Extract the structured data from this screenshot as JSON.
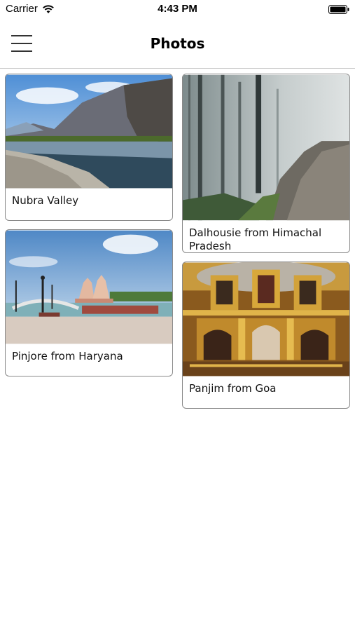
{
  "status_bar": {
    "carrier": "Carrier",
    "time": "4:43 PM",
    "wifi_icon": "wifi-icon",
    "battery_icon": "battery-icon"
  },
  "nav": {
    "title": "Photos",
    "menu_icon": "hamburger-menu-icon"
  },
  "photos": [
    {
      "caption": "Nubra Valley",
      "image": "mountain-lake-photo"
    },
    {
      "caption": "Dalhousie from Himachal Pradesh",
      "image": "misty-forest-path-photo"
    },
    {
      "caption": "Pinjore from Haryana",
      "image": "garden-bridge-temple-photo"
    },
    {
      "caption": "Panjim from Goa",
      "image": "golden-church-altar-photo"
    }
  ],
  "colors": {
    "card_border": "#8a8a8a",
    "divider": "#c9c9c9",
    "background": "#ffffff"
  }
}
